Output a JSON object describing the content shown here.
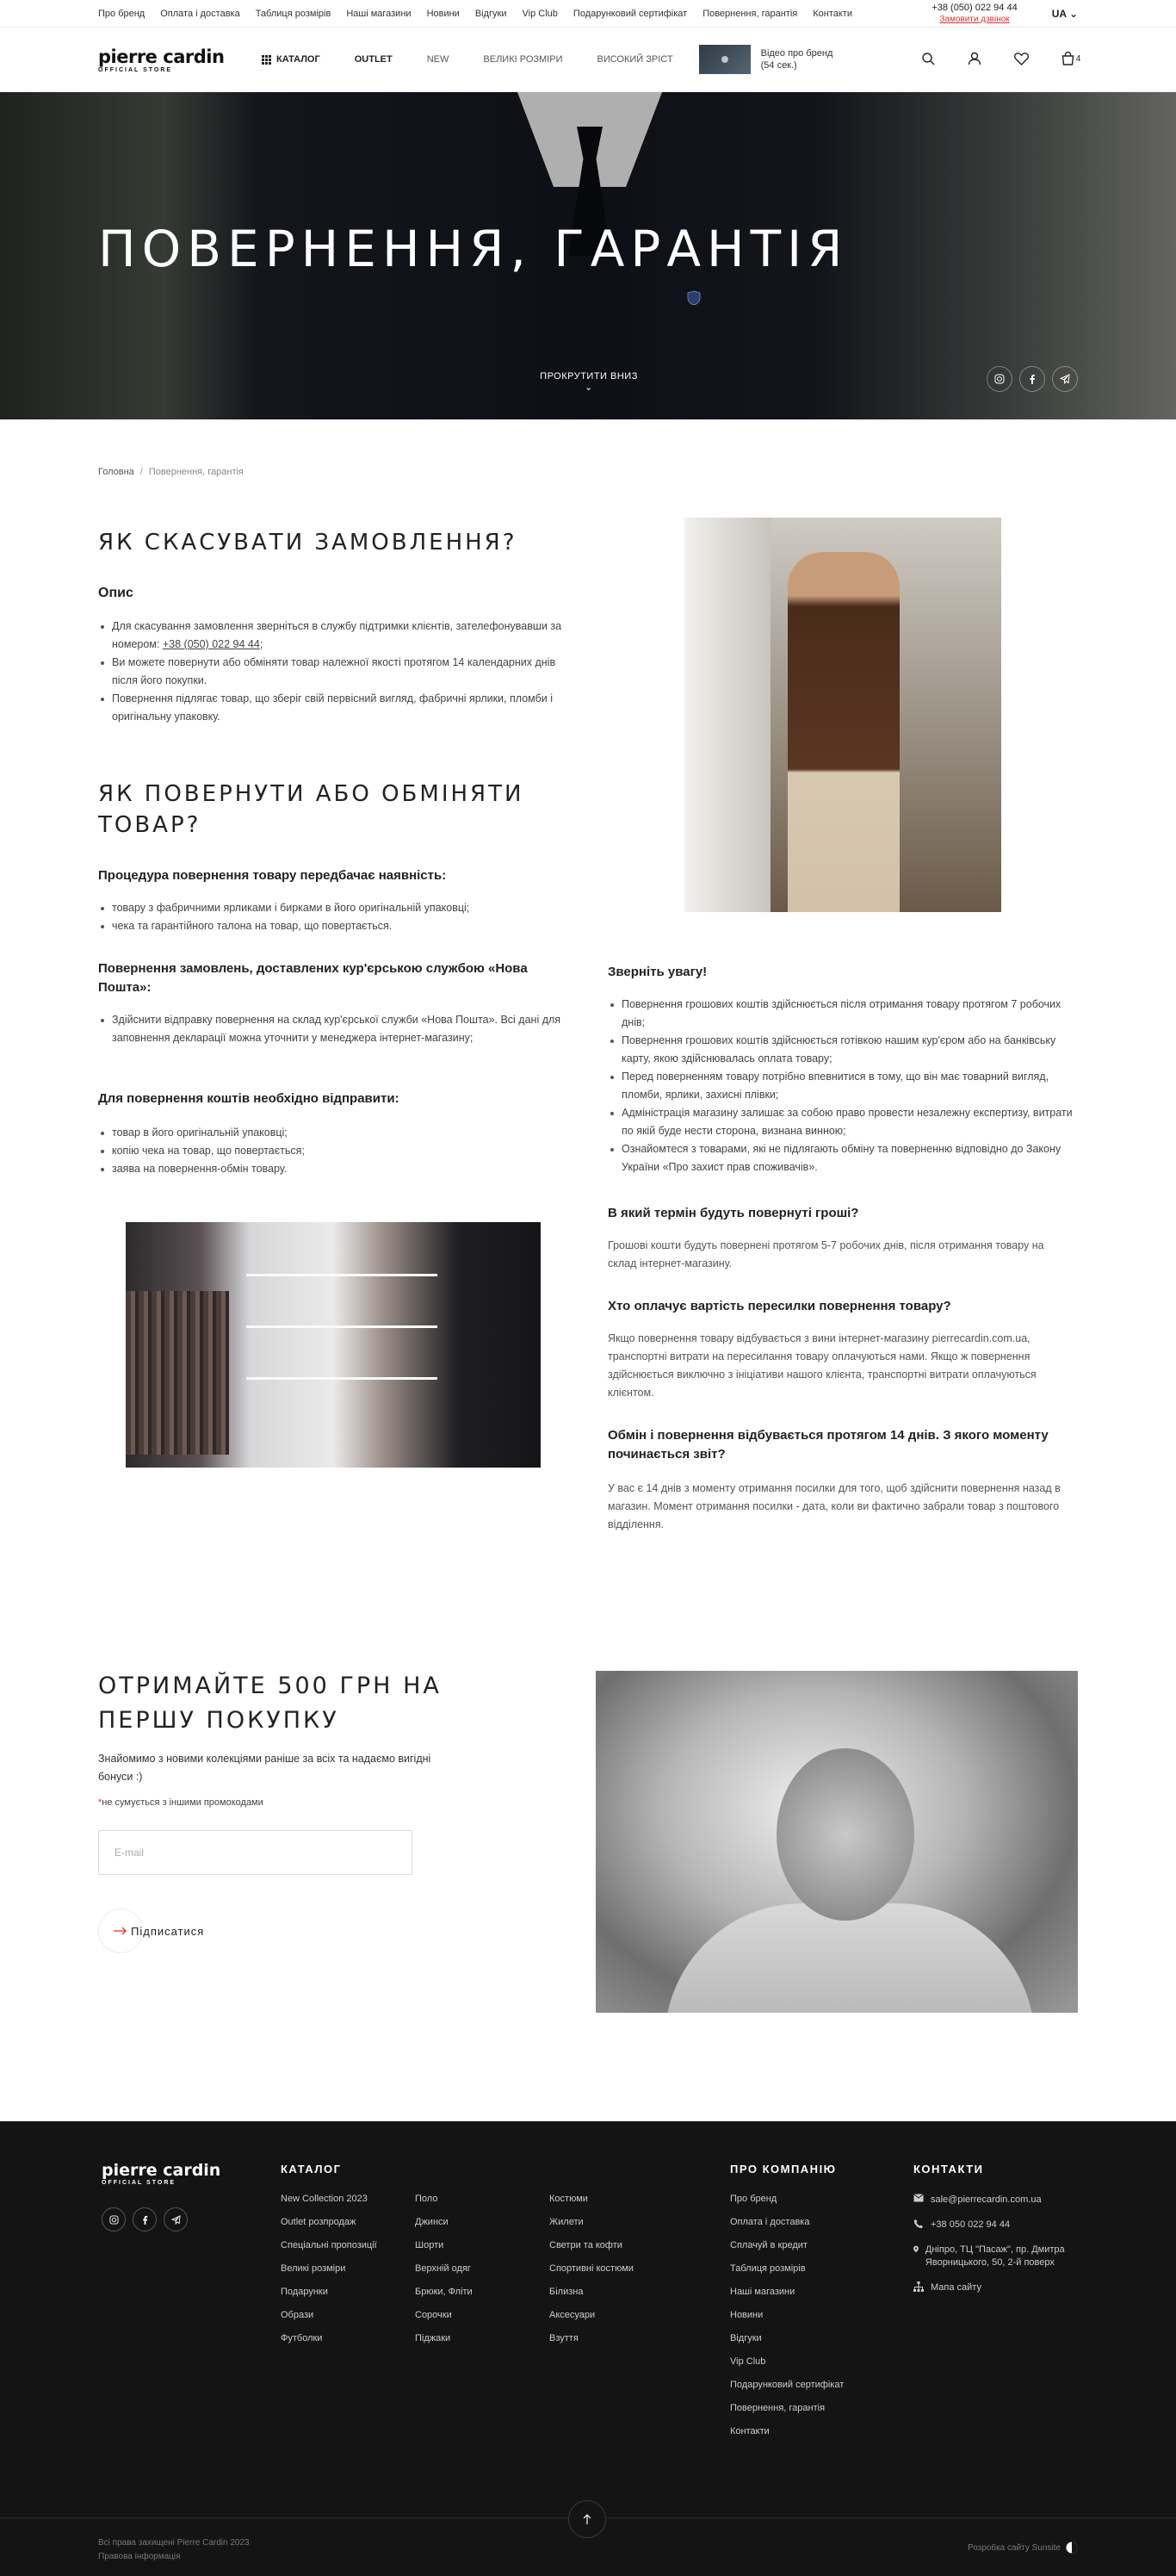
{
  "topbar": {
    "links": [
      "Про бренд",
      "Оплата і доставка",
      "Таблиця розмірів",
      "Наші магазини",
      "Новини",
      "Відгуки",
      "Vip Club",
      "Подарунковий сертифікат",
      "Повернення, гарантія",
      "Контакти"
    ],
    "phone": "+38 (050) 022 94 44",
    "callback": "Замовити дзвінок",
    "lang": "UA"
  },
  "header": {
    "logo_main": "pierre cardin",
    "logo_sub": "OFFICIAL STORE",
    "catalog": "Каталог",
    "outlet": "Outlet",
    "nav": [
      "New",
      "Великі розміри",
      "Високий зріст"
    ],
    "video_title": "Відео про бренд",
    "video_duration": "(54 сек.)",
    "cart_count": "4"
  },
  "hero": {
    "title": "ПОВЕРНЕННЯ, ГАРАНТІЯ",
    "scroll": "ПРОКРУТИТИ ВНИЗ"
  },
  "breadcrumbs": {
    "home": "Головна",
    "current": "Повернення, гарантія"
  },
  "cancel": {
    "title": "ЯК СКАСУВАТИ ЗАМОВЛЕННЯ?",
    "subtitle": "Опис",
    "item1_pre": "Для скасування замовлення зверніться в службу підтримки клієнтів, зателефонувавши за номером: ",
    "item1_phone": "+38 (050) 022 94 44",
    "item1_post": ";",
    "item2": "Ви можете повернути або обміняти товар належної якості протягом 14 календарних днів після його покупки.",
    "item3": "Повернення підлягає товар, що зберіг свій первісний вигляд, фабричні ярлики, пломби і оригінальну упаковку."
  },
  "returns": {
    "title": "ЯК ПОВЕРНУТИ АБО ОБМІНЯТИ ТОВАР?",
    "procedure_title": "Процедура повернення товару передбачає наявність:",
    "procedure_items": [
      "товару з фабричними ярликами і бирками в його оригінальній упаковці;",
      "чека та гарантійного талона на товар, що повертається."
    ],
    "np_title": "Повернення замовлень, доставлених кур'єрською службою «Нова Пошта»:",
    "np_items": [
      "Здійснити відправку повернення на склад кур'єрської служби «Нова Пошта». Всі дані для заповнення декларації можна уточнити у менеджера інтернет-магазину;"
    ],
    "refund_title": "Для повернення коштів необхідно відправити:",
    "refund_items": [
      "товар в його оригінальній упаковці;",
      "копію чека на товар, що повертається;",
      "заява на повернення-обмін товару."
    ]
  },
  "attention": {
    "title": "Зверніть увагу!",
    "items": [
      "Повернення грошових коштів здійснюється після отримання товару протягом 7 робочих днів;",
      "Повернення грошових коштів здійснюється готівкою нашим кур'єром або на банківську карту, якою здійснювалась оплата товару;",
      "Перед поверненням товару потрібно впевнитися в тому, що він має товарний вигляд, пломби, ярлики, захисні плівки;",
      "Адміністрація магазину залишає за собою право провести незалежну експертизу, витрати по якій буде нести сторона, визнана винною;",
      "Ознайомтеся з товарами, які не підлягають обміну та поверненню відповідно до Закону України «Про захист прав споживачів»."
    ],
    "q1": "В який термін будуть повернуті гроші?",
    "a1": "Грошові кошти будуть повернені протягом 5-7 робочих днів, після отримання товару на склад інтернет-магазину.",
    "q2": "Хто оплачує вартість пересилки повернення товару?",
    "a2": "Якщо повернення товару відбувається з вини інтернет-магазину pierrecardin.com.ua, транспортні витрати на пересилання товару оплачуються нами. Якщо ж повернення здійснюється виключно з ініціативи нашого клієнта, транспортні витрати оплачуються клієнтом.",
    "q3": "Обмін і повернення відбувається протягом 14 днів. З якого моменту починається звіт?",
    "a3": "У вас є 14 днів з моменту отримання посилки для того, щоб здійснити повернення назад в магазин. Момент отримання посилки - дата, коли ви фактично забрали товар з поштового відділення."
  },
  "newsletter": {
    "title": "ОТРИМАЙТЕ 500 ГРН НА ПЕРШУ ПОКУПКУ",
    "text": "Знайомимо з новими колекціями раніше за всіх та надаємо вигідні бонуси :)",
    "note_star": "*",
    "note": "не сумується з іншими промокодами",
    "placeholder": "E-mail",
    "button": "Підписатися"
  },
  "footer": {
    "catalog_title": "КАТАЛОГ",
    "col1": [
      "New Collection 2023",
      "Outlet розпродаж",
      "Спеціальні пропозиції",
      "Великі розміри",
      "Подарунки",
      "Образи",
      "Футболки"
    ],
    "col2": [
      "Поло",
      "Джинси",
      "Шорти",
      "Верхній одяг",
      "Брюки, Фліти",
      "Сорочки",
      "Піджаки"
    ],
    "col3": [
      "Костюми",
      "Жилети",
      "Светри та кофти",
      "Спортивні костюми",
      "Білизна",
      "Аксесуари",
      "Взуття"
    ],
    "company_title": "ПРО КОМПАНІЮ",
    "company": [
      "Про бренд",
      "Оплата і доставка",
      "Сплачуй в кредит",
      "Таблиця розмірів",
      "Наші магазини",
      "Новини",
      "Відгуки",
      "Vip Club",
      "Подарунковий сертифікат",
      "Повернення, гарантія",
      "Контакти"
    ],
    "contacts_title": "КОНТАКТИ",
    "email": "sale@pierrecardin.com.ua",
    "phone": "+38 050 022 94 44",
    "address": "Дніпро, ТЦ \"Пасаж\", пр. Дмитра Яворницького, 50, 2-й поверх",
    "sitemap": "Мапа сайту",
    "copyright": "Всі права захищені Pierre Cardin 2023",
    "legal": "Правова інформація",
    "developer": "Розробка сайту Sunsite"
  }
}
